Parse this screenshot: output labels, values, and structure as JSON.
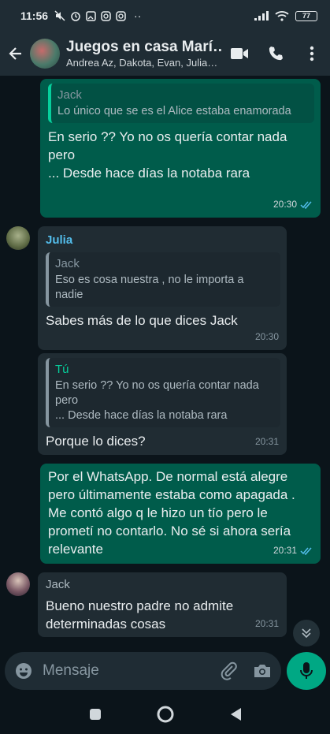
{
  "status_bar": {
    "time": "11:56",
    "battery": "77"
  },
  "header": {
    "title": "Juegos en casa Marí…",
    "subtitle": "Andrea Az, Dakota, Evan, Julia…"
  },
  "messages": [
    {
      "direction": "out",
      "quote_name": "Jack",
      "quote_text": "Lo único que se es el Alice estaba enamorada",
      "text": "En serio ?? Yo no os quería contar nada pero\n... Desde hace días la notaba rara",
      "time": "20:30"
    },
    {
      "direction": "in",
      "sender": "Julia",
      "quote_name": "Jack",
      "quote_text": "Eso es cosa nuestra  , no le importa a nadie",
      "text": "Sabes más de lo que dices Jack",
      "time": "20:30"
    },
    {
      "direction": "in",
      "quote_name": "Tú",
      "quote_text": "En serio ?? Yo no os quería contar nada pero\n... Desde hace días la notaba rara",
      "text": "Porque lo dices?",
      "time": "20:31"
    },
    {
      "direction": "out",
      "text": "Por el WhatsApp. De normal está alegre pero últimamente estaba como apagada . Me contó algo q le hizo un tío pero le prometí no contarlo. No sé si ahora sería relevante",
      "time": "20:31"
    },
    {
      "direction": "in",
      "sender": "Jack",
      "text": "Bueno  nuestro padre no admite determinadas cosas",
      "time": "20:31"
    }
  ],
  "input": {
    "placeholder": "Mensaje"
  },
  "colors": {
    "outgoing": "#005c4b",
    "incoming": "#202c33",
    "accent": "#00a884"
  }
}
